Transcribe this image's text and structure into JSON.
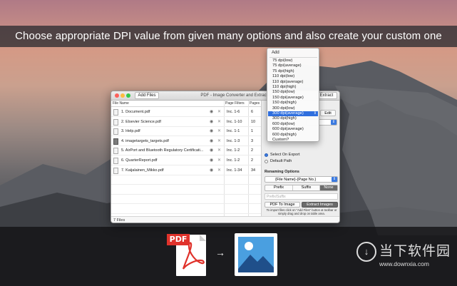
{
  "banner": {
    "text": "Choose appropriate DPI value from given many options and also create your custom one"
  },
  "window": {
    "title": "PDF - Image Converter and Extractor",
    "toolbar": {
      "add_files_label": "Add Files",
      "extract_label": "Extract"
    },
    "table": {
      "headers": {
        "file_name": "File Name",
        "page_filters": "Page Filters",
        "pages": "Pages"
      },
      "rows": [
        {
          "name": "1. Document.pdf",
          "filter": "Inc. 1-6",
          "pages": "6",
          "icon": "document-icon"
        },
        {
          "name": "2. Elsevier Science.pdf",
          "filter": "Inc. 1-10",
          "pages": "10",
          "icon": "document-icon"
        },
        {
          "name": "3. Help.pdf",
          "filter": "Inc. 1-1",
          "pages": "1",
          "icon": "document-icon"
        },
        {
          "name": "4. imagetargets_targets.pdf",
          "filter": "Inc. 1-3",
          "pages": "3",
          "icon": "image-document-icon"
        },
        {
          "name": "5. AirPort and Bluetooth Regulatory Certificati...",
          "filter": "Inc. 1-2",
          "pages": "2",
          "icon": "document-icon"
        },
        {
          "name": "6. QuarterReport.pdf",
          "filter": "Inc. 1-2",
          "pages": "2",
          "icon": "document-icon"
        },
        {
          "name": "7. Kaijalainen_Mikko.pdf",
          "filter": "Inc. 1-34",
          "pages": "34",
          "icon": "document-icon"
        }
      ],
      "row_icons": {
        "preview": "eye-icon",
        "remove": "close-icon"
      }
    },
    "status": {
      "file_count": "7 Files"
    },
    "side_panel": {
      "edit_label": "Edit",
      "output": {
        "select_on_export": "Select On Export",
        "default_path": "Default Path"
      },
      "renaming": {
        "heading": "Renaming Options",
        "pattern_value": "{File Name}-{Page No.}",
        "tabs": [
          "Prefix",
          "Suffix",
          "None"
        ],
        "selected_tab": "None",
        "input_placeholder": "Prefix/Suffix"
      },
      "actions": {
        "pdf_to_image": "PDF To Image",
        "extract_images": "Extract Images"
      },
      "hint": "To import files click on \"Add Files\" button at toolbar or simply drag and drop on table area."
    }
  },
  "dpi_dropdown": {
    "add_label": "Add",
    "options": [
      "75 dpi(low)",
      "75 dpi(average)",
      "75 dpi(high)",
      "110 dpi(low)",
      "110 dpi(average)",
      "110 dpi(high)",
      "150 dpi(low)",
      "150 dpi(average)",
      "150 dpi(high)",
      "300 dpi(low)",
      "300 dpi(average)",
      "300 dpi(high)",
      "600 dpi(low)",
      "600 dpi(average)",
      "600 dpi(high)",
      "Custom?"
    ],
    "selected": "300 dpi(average)"
  },
  "bottom": {
    "pdf_tag": "PDF",
    "arrow": "→"
  },
  "watermark": {
    "chinese": "当下软件园",
    "url": "www.downxia.com"
  },
  "colors": {
    "accent": "#2f6fde",
    "pdf_red": "#e0322b",
    "image_blue": "#4a9fe0"
  }
}
